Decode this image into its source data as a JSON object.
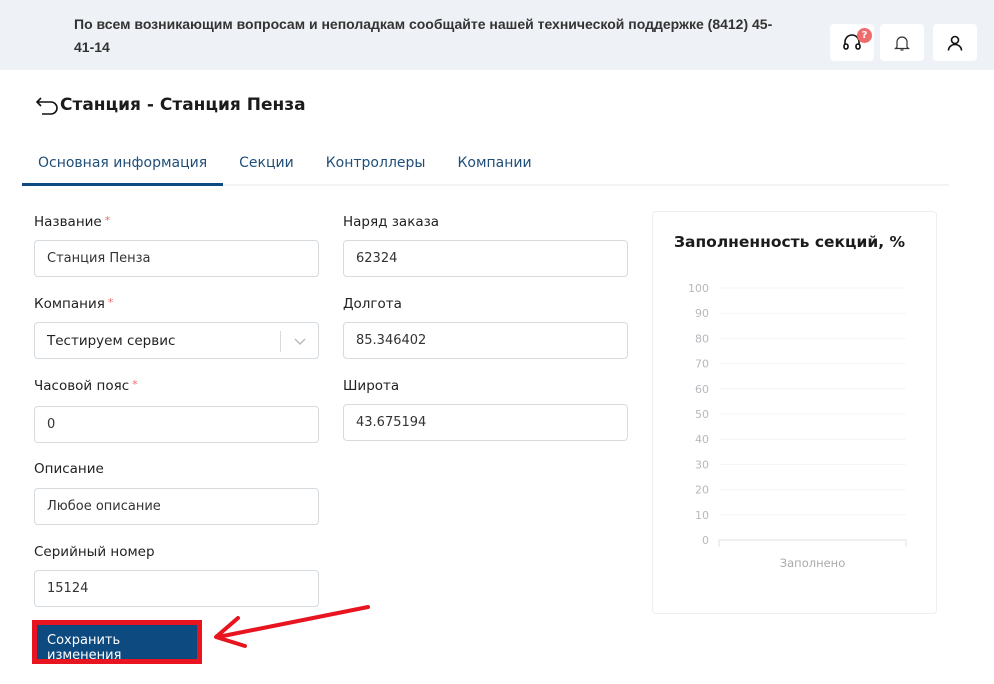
{
  "header": {
    "notice": "По всем возникающим вопросам и неполадкам сообщайте нашей технической поддержке (8412) 45-41-14",
    "support_badge": "?"
  },
  "page": {
    "title": "Станция - Станция Пенза"
  },
  "tabs": [
    {
      "label": "Основная информация",
      "active": true
    },
    {
      "label": "Секции"
    },
    {
      "label": "Контроллеры"
    },
    {
      "label": "Компании"
    }
  ],
  "form": {
    "name": {
      "label": "Название",
      "required": "*",
      "value": "Станция Пенза"
    },
    "company": {
      "label": "Компания",
      "required": "*",
      "value": "Тестируем сервис"
    },
    "timezone": {
      "label": "Часовой пояс",
      "required": "*",
      "value": "0"
    },
    "description": {
      "label": "Описание",
      "value": "Любое описание"
    },
    "serial": {
      "label": "Серийный номер",
      "value": "15124"
    },
    "order": {
      "label": "Наряд заказа",
      "value": "62324"
    },
    "longitude": {
      "label": "Долгота",
      "value": "85.346402"
    },
    "latitude": {
      "label": "Широта",
      "value": "43.675194"
    },
    "save_label": "Сохранить изменения"
  },
  "chart_data": {
    "type": "bar",
    "title": "Заполненность секций, %",
    "categories": [
      "Заполнено"
    ],
    "values": [
      null
    ],
    "ylim": [
      0,
      100
    ],
    "yticks": [
      "0",
      "10",
      "20",
      "30",
      "40",
      "50",
      "60",
      "70",
      "80",
      "90",
      "100"
    ],
    "grid": true
  },
  "colors": {
    "accent": "#0d4a80",
    "highlight": "#e8141f",
    "badge": "#f06b6b"
  }
}
